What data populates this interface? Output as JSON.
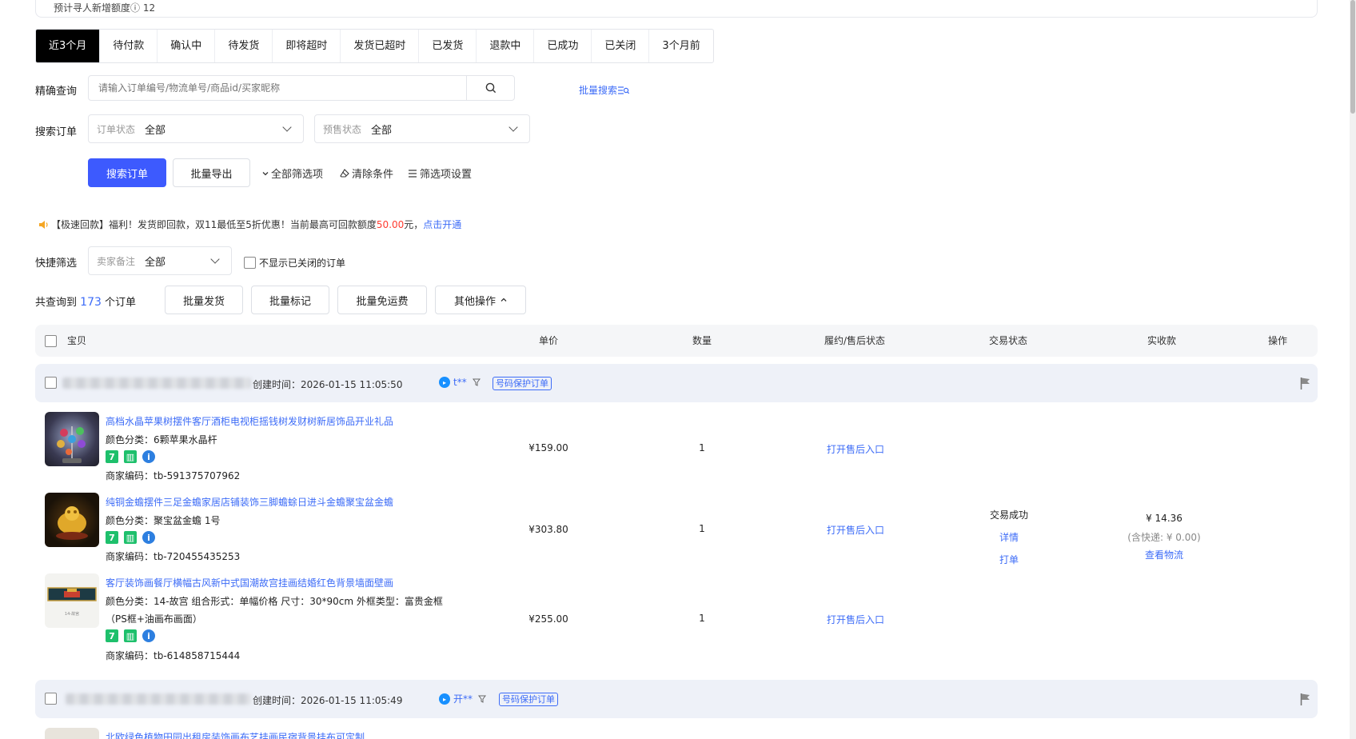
{
  "top_panel": {
    "partial_text": "预计寻人新增额度ⓘ 12"
  },
  "tabs": [
    {
      "label": "近3个月",
      "active": true
    },
    {
      "label": "待付款"
    },
    {
      "label": "确认中"
    },
    {
      "label": "待发货"
    },
    {
      "label": "即将超时"
    },
    {
      "label": "发货已超时"
    },
    {
      "label": "已发货"
    },
    {
      "label": "退款中"
    },
    {
      "label": "已成功"
    },
    {
      "label": "已关闭"
    },
    {
      "label": "3个月前"
    }
  ],
  "exact_query": {
    "label": "精确查询",
    "placeholder": "请输入订单编号/物流单号/商品id/买家昵称",
    "batch_search": "批量搜索"
  },
  "search_order": {
    "label": "搜索订单",
    "order_status_label": "订单状态",
    "order_status_value": "全部",
    "presale_status_label": "预售状态",
    "presale_status_value": "全部"
  },
  "actions": {
    "search_btn": "搜索订单",
    "export_btn": "批量导出",
    "all_filters": "全部筛选项",
    "clear": "清除条件",
    "filter_settings": "筛选项设置"
  },
  "notice": {
    "prefix": "【极速回款】福利！发货即回款，双11最低至5折优惠！当前最高可回款额度",
    "amount": "50.00",
    "suffix": "元，",
    "link": "点击开通"
  },
  "quick_filter": {
    "label": "快捷筛选",
    "seller_note_label": "卖家备注",
    "seller_note_value": "全部",
    "hide_closed": "不显示已关闭的订单"
  },
  "summary": {
    "prefix": "共查询到",
    "count": "173",
    "suffix": "个订单",
    "batch_ship": "批量发货",
    "batch_mark": "批量标记",
    "batch_free": "批量免运费",
    "other_ops": "其他操作"
  },
  "table_header": {
    "item": "宝贝",
    "price": "单价",
    "qty": "数量",
    "fulfill": "履约/售后状态",
    "trade": "交易状态",
    "received": "实收款",
    "ops": "操作"
  },
  "orders": [
    {
      "created": "创建时间：2026-01-15 11:05:50",
      "buyer": "t**",
      "tag": "号码保护订单",
      "trade_status": "交易成功",
      "detail": "详情",
      "print": "打单",
      "amount": "¥ 14.36",
      "shipping": "(含快递: ¥ 0.00)",
      "logistics": "查看物流",
      "items": [
        {
          "title": "高档水晶苹果树摆件客厅酒柜电视柜摇钱树发财树新居饰品开业礼品",
          "spec_1": "颜色分类：6颗苹果水晶杆",
          "spec_2": "",
          "code": "商家编码：tb-591375707962",
          "price": "¥159.00",
          "qty": "1",
          "after_sale": "打开售后入口"
        },
        {
          "title": "纯铜金蟾摆件三足金蟾家居店铺装饰三脚蟾蜍日进斗金蟾聚宝盆金蟾",
          "spec_1": "颜色分类：聚宝盆金蟾 1号",
          "spec_2": "",
          "code": "商家编码：tb-720455435253",
          "price": "¥303.80",
          "qty": "1",
          "after_sale": "打开售后入口"
        },
        {
          "title": "客厅装饰画餐厅横幅古风新中式国潮故宫挂画结婚红色背景墙面壁画",
          "spec_1": "颜色分类：14-故宫   组合形式：单幅价格   尺寸：30*90cm   外框类型：富贵金框",
          "spec_2": "（PS框+油画布画面）",
          "code": "商家编码：tb-614858715444",
          "price": "¥255.00",
          "qty": "1",
          "after_sale": "打开售后入口"
        }
      ]
    },
    {
      "created": "创建时间：2026-01-15 11:05:49",
      "buyer": "开**",
      "tag": "号码保护订单",
      "items": [
        {
          "title": "北欧绿色植物田园出租房装饰画布艺挂画民宿背景挂布可定制"
        }
      ]
    }
  ],
  "colors": {
    "primary": "#3d5afe",
    "link": "#3d6cf7",
    "price_red": "#ff3b30",
    "tab_active": "#000000"
  }
}
